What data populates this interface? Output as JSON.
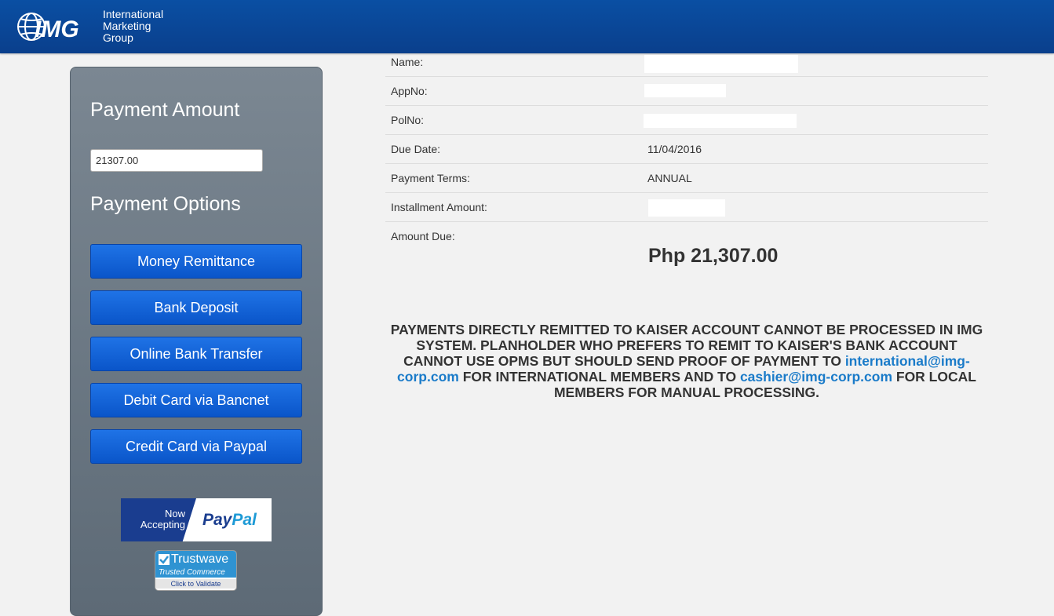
{
  "header": {
    "brand_mark": "IMG",
    "company_lines": [
      "International",
      "Marketing",
      "Group"
    ]
  },
  "sidebar": {
    "amount_heading": "Payment Amount",
    "amount_value": "21307.00",
    "options_heading": "Payment Options",
    "buttons": [
      "Money Remittance",
      "Bank Deposit",
      "Online Bank Transfer",
      "Debit Card via Bancnet",
      "Credit Card via Paypal"
    ],
    "paypal_badge": {
      "line1": "Now",
      "line2": "Accepting",
      "pay": "Pay",
      "pal": "Pal"
    },
    "trustwave": {
      "name": "Trustwave",
      "tagline": "Trusted Commerce",
      "cta": "Click to Validate"
    }
  },
  "details": {
    "rows": [
      {
        "label": "Name:",
        "value": ""
      },
      {
        "label": "AppNo:",
        "value": ""
      },
      {
        "label": "PolNo:",
        "value": ""
      },
      {
        "label": "Due Date:",
        "value": "11/04/2016"
      },
      {
        "label": "Payment Terms:",
        "value": "ANNUAL"
      },
      {
        "label": "Installment Amount:",
        "value": ""
      }
    ],
    "amount_due_label": "Amount Due:",
    "amount_due_value": "Php 21,307.00"
  },
  "notice": {
    "part1": "PAYMENTS DIRECTLY REMITTED TO KAISER ACCOUNT CANNOT BE PROCESSED IN IMG SYSTEM. PLANHOLDER WHO PREFERS TO REMIT TO KAISER'S BANK ACCOUNT CANNOT USE OPMS BUT SHOULD SEND PROOF OF PAYMENT TO ",
    "email1": "international@img-corp.com",
    "part2": " FOR INTERNATIONAL MEMBERS AND TO ",
    "email2": "cashier@img-corp.com",
    "part3": " FOR LOCAL MEMBERS FOR MANUAL PROCESSING."
  },
  "colors": {
    "header_blue": "#0a4fa3",
    "button_blue": "#1f73e6",
    "link_blue": "#1a7bc9",
    "sidebar_gray": "#6b7884"
  }
}
